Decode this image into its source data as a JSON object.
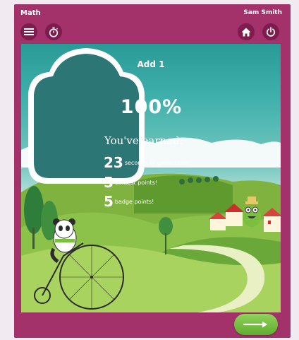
{
  "app": {
    "title": "Math",
    "user_name": "Sam Smith"
  },
  "toolbar": {
    "menu_icon": "hamburger-menu-icon",
    "timer_icon": "stopwatch-icon",
    "home_icon": "home-icon",
    "power_icon": "power-icon"
  },
  "activity": {
    "title": "Add 1"
  },
  "results": {
    "score": "100%",
    "earned_heading": "You've earned:",
    "rewards": [
      {
        "value": "23",
        "label": "seconds of game time!"
      },
      {
        "value": "5",
        "label": "contest points!"
      },
      {
        "value": "5",
        "label": "badge points!"
      }
    ]
  },
  "next_button": {
    "icon": "right-arrow-icon"
  },
  "colors": {
    "frame": "#a3326a",
    "button_dark": "#7e1c4f",
    "badge": "#1b6a6a",
    "next": "#6cbf3b"
  }
}
